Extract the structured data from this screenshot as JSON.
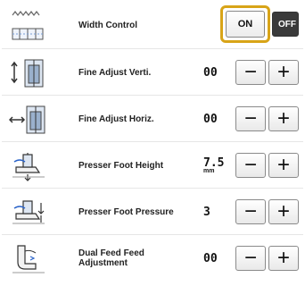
{
  "rows": [
    {
      "label": "Width Control",
      "type": "toggle",
      "on_label": "ON",
      "off_label": "OFF",
      "icon": "width-control-icon"
    },
    {
      "label": "Fine Adjust Verti.",
      "type": "stepper",
      "value": "00",
      "minus": "−",
      "plus": "+",
      "icon": "fine-adjust-vertical-icon"
    },
    {
      "label": "Fine Adjust Horiz.",
      "type": "stepper",
      "value": "00",
      "minus": "−",
      "plus": "+",
      "icon": "fine-adjust-horizontal-icon"
    },
    {
      "label": "Presser Foot Height",
      "type": "stepper",
      "value": "7.5",
      "unit": "mm",
      "minus": "−",
      "plus": "+",
      "icon": "presser-foot-height-icon"
    },
    {
      "label": "Presser Foot Pressure",
      "type": "stepper",
      "value": "3",
      "minus": "−",
      "plus": "+",
      "icon": "presser-foot-pressure-icon"
    },
    {
      "label": "Dual Feed Feed Adjustment",
      "type": "stepper",
      "value": "00",
      "minus": "−",
      "plus": "+",
      "icon": "dual-feed-icon"
    }
  ],
  "colors": {
    "highlight": "#d8a418",
    "off_button": "#3a3a3a"
  }
}
